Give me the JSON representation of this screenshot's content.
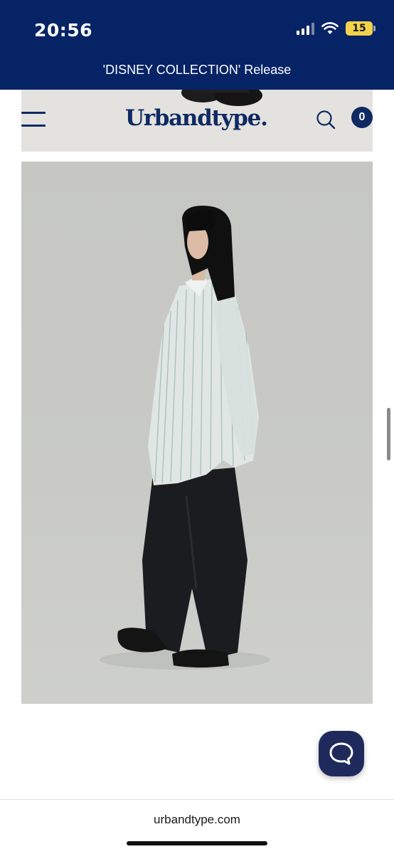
{
  "status_bar": {
    "time": "20:56",
    "battery": "15"
  },
  "announcement": {
    "text": "'DISNEY COLLECTION' Release"
  },
  "header": {
    "logo": "Urbandtype.",
    "cart_count": "0",
    "icons": [
      "menu-icon",
      "search-icon",
      "cart-icon"
    ]
  },
  "browser": {
    "url": "urbandtype.com"
  },
  "colors": {
    "brand_navy": "#062366",
    "logo_navy": "#0e2a63",
    "chat_button": "#1f2a5c",
    "battery_yellow": "#f2d24b",
    "image_background": "#c8c9c5"
  }
}
